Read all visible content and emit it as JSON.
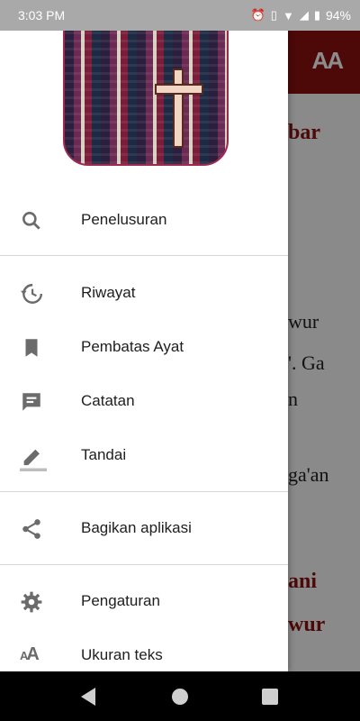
{
  "status": {
    "time": "3:03 PM",
    "battery": "94%"
  },
  "app": {
    "toolbar_icon": "text-size-icon",
    "toolbar_text": "AA",
    "content": [
      {
        "text": "bar",
        "kind": "heading"
      },
      {
        "text": "wur",
        "kind": "para"
      },
      {
        "text": "'. Ga",
        "kind": "para"
      },
      {
        "text": "n",
        "kind": "para"
      },
      {
        "text": "ga'an",
        "kind": "para"
      },
      {
        "text": "ani",
        "kind": "heading"
      },
      {
        "text": "wur",
        "kind": "heading"
      }
    ]
  },
  "drawer": {
    "items": [
      {
        "label": "Penelusuran",
        "icon": "search-icon"
      },
      {
        "label": "Riwayat",
        "icon": "history-icon"
      },
      {
        "label": "Pembatas Ayat",
        "icon": "bookmark-icon"
      },
      {
        "label": "Catatan",
        "icon": "note-icon"
      },
      {
        "label": "Tandai",
        "icon": "highlight-pen-icon"
      },
      {
        "label": "Bagikan aplikasi",
        "icon": "share-icon"
      },
      {
        "label": "Pengaturan",
        "icon": "gear-icon"
      },
      {
        "label": "Ukuran teks",
        "icon": "text-size-icon"
      }
    ]
  },
  "colors": {
    "accent": "#8d0f0f",
    "icon": "#6b6b6b"
  }
}
